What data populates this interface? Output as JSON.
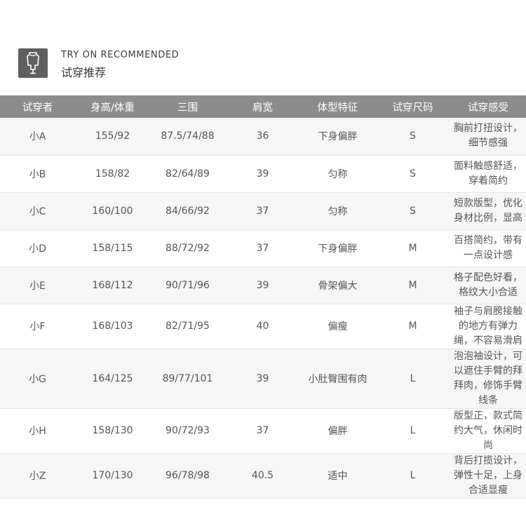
{
  "header": {
    "title_en": "TRY ON RECOMMENDED",
    "title_cn": "试穿推荐",
    "logo_icon": "dress-form-icon"
  },
  "table": {
    "columns": [
      "试穿者",
      "身高/体重",
      "三围",
      "肩宽",
      "体型特征",
      "试穿尺码",
      "试穿感受"
    ],
    "rows": [
      {
        "name": "小A",
        "hw": "155/92",
        "bwh": "87.5/74/88",
        "shoulder": "36",
        "body": "下身偏胖",
        "size": "S",
        "feel": [
          "胸前打扭设计，",
          "细节感强"
        ]
      },
      {
        "name": "小B",
        "hw": "158/82",
        "bwh": "82/64/89",
        "shoulder": "39",
        "body": "匀称",
        "size": "S",
        "feel": [
          "面料触感舒适，",
          "穿着简约"
        ]
      },
      {
        "name": "小C",
        "hw": "160/100",
        "bwh": "84/66/92",
        "shoulder": "37",
        "body": "匀称",
        "size": "S",
        "feel": [
          "短款版型，优化",
          "身材比例，显高"
        ]
      },
      {
        "name": "小D",
        "hw": "158/115",
        "bwh": "88/72/92",
        "shoulder": "37",
        "body": "下身偏胖",
        "size": "M",
        "feel": [
          "百搭简约，带有",
          "一点设计感"
        ]
      },
      {
        "name": "小E",
        "hw": "168/112",
        "bwh": "90/71/96",
        "shoulder": "39",
        "body": "骨架偏大",
        "size": "M",
        "feel": [
          "格子配色好看，",
          "格纹大小合适"
        ]
      },
      {
        "name": "小F",
        "hw": "168/103",
        "bwh": "82/71/95",
        "shoulder": "40",
        "body": "偏瘦",
        "size": "M",
        "feel": [
          "袖子与肩膀接触",
          "的地方有弹力",
          "绳，不容易滑肩"
        ]
      },
      {
        "name": "小G",
        "hw": "164/125",
        "bwh": "89/77/101",
        "shoulder": "39",
        "body": "小肚臀围有肉",
        "size": "L",
        "feel": [
          "泡泡袖设计，可",
          "以遮住手臂的拜",
          "拜肉，修饰手臂",
          "线条"
        ]
      },
      {
        "name": "小H",
        "hw": "158/130",
        "bwh": "90/72/93",
        "shoulder": "37",
        "body": "偏胖",
        "size": "L",
        "feel": [
          "版型正，款式简",
          "约大气，休闲时",
          "尚"
        ]
      },
      {
        "name": "小Z",
        "hw": "170/130",
        "bwh": "96/78/98",
        "shoulder": "40.5",
        "body": "适中",
        "size": "L",
        "feel": [
          "背后打揽设计，",
          "弹性十足，上身",
          "合适显瘦"
        ]
      }
    ]
  }
}
